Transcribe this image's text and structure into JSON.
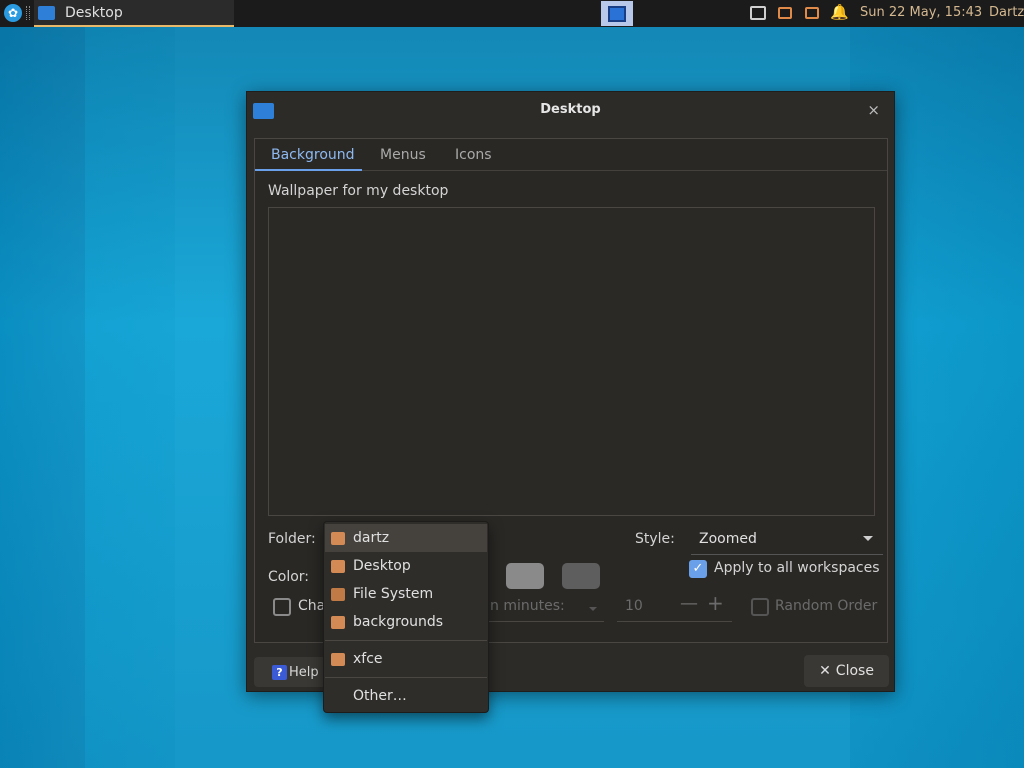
{
  "panel": {
    "menu_icon": "xfce-mouse-icon",
    "task_title": "Desktop",
    "clock": "Sun 22 May, 15:43",
    "user": "Dartz"
  },
  "dialog": {
    "title": "Desktop",
    "close_glyph": "×",
    "tabs": [
      "Background",
      "Menus",
      "Icons"
    ],
    "wallpaper_label": "Wallpaper for my desktop",
    "folder_label": "Folder:",
    "style_label": "Style:",
    "style_value": "Zoomed",
    "color_label": "Color:",
    "apply_all_label": "Apply to all workspaces",
    "apply_all_checked": true,
    "change_label_partial": "Cha",
    "minutes_label_partial": "n minutes:",
    "minutes_value": "10",
    "random_order_label": "Random Order",
    "help_label": "Help",
    "close_label": "Close",
    "colors": {
      "color1": "#8a8a8a",
      "color2": "#5e5e5e"
    }
  },
  "folder_menu": {
    "items": [
      {
        "label": "dartz",
        "icon": "home-folder-icon"
      },
      {
        "label": "Desktop",
        "icon": "desktop-folder-icon"
      },
      {
        "label": "File System",
        "icon": "drive-icon"
      },
      {
        "label": "backgrounds",
        "icon": "folder-icon"
      },
      {
        "label": "xfce",
        "icon": "folder-icon"
      },
      {
        "label": "Other…",
        "icon": ""
      }
    ]
  }
}
